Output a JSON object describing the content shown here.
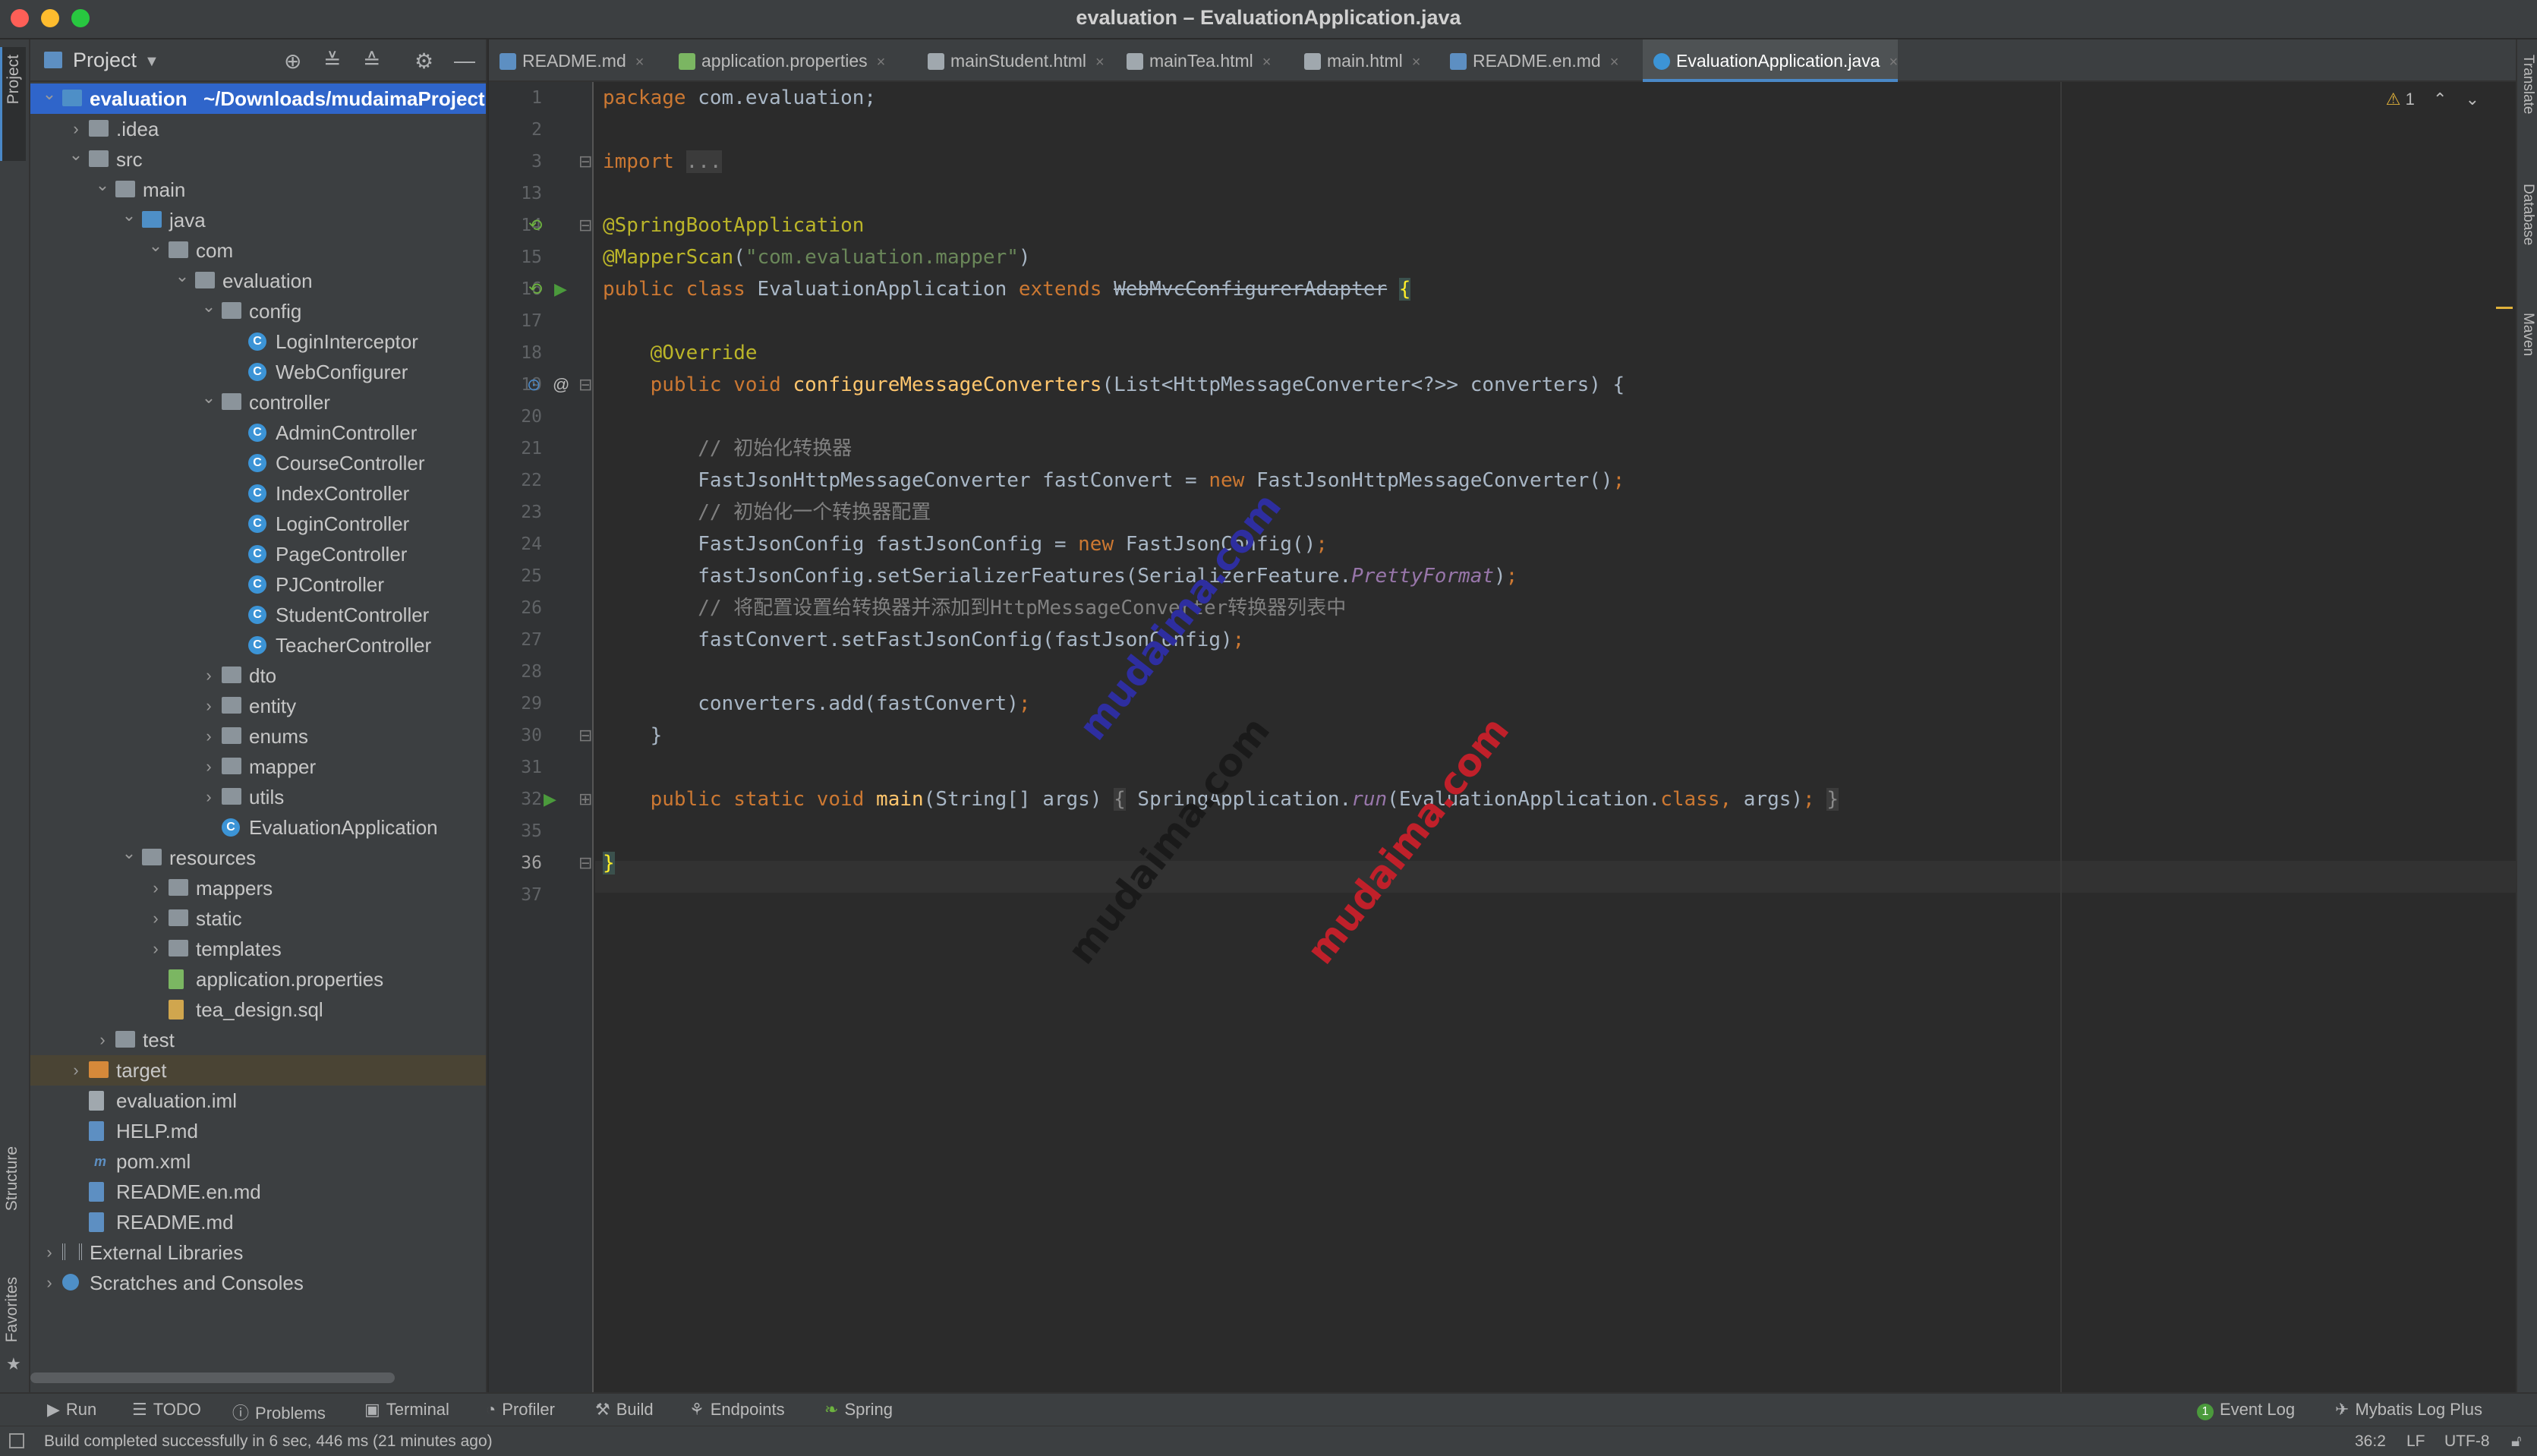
{
  "window": {
    "title": "evaluation – EvaluationApplication.java"
  },
  "left_strip": {
    "project_label": "Project",
    "structure_label": "Structure",
    "favorites_label": "Favorites"
  },
  "right_strip": {
    "translate_label": "Translate",
    "database_label": "Database",
    "maven_label": "Maven"
  },
  "project_panel": {
    "title": "Project",
    "tree": [
      {
        "label": "evaluation",
        "suffix": "~/Downloads/mudaimaProject",
        "level": 0,
        "arrow": "down",
        "icon": "folder-module",
        "selected": true
      },
      {
        "label": ".idea",
        "level": 1,
        "arrow": "right",
        "icon": "folder"
      },
      {
        "label": "src",
        "level": 1,
        "arrow": "down",
        "icon": "folder"
      },
      {
        "label": "main",
        "level": 2,
        "arrow": "down",
        "icon": "folder"
      },
      {
        "label": "java",
        "level": 3,
        "arrow": "down",
        "icon": "folder-blue"
      },
      {
        "label": "com",
        "level": 4,
        "arrow": "down",
        "icon": "folder"
      },
      {
        "label": "evaluation",
        "level": 5,
        "arrow": "down",
        "icon": "folder"
      },
      {
        "label": "config",
        "level": 6,
        "arrow": "down",
        "icon": "folder"
      },
      {
        "label": "LoginInterceptor",
        "level": 7,
        "icon": "class"
      },
      {
        "label": "WebConfigurer",
        "level": 7,
        "icon": "class"
      },
      {
        "label": "controller",
        "level": 6,
        "arrow": "down",
        "icon": "folder"
      },
      {
        "label": "AdminController",
        "level": 7,
        "icon": "class"
      },
      {
        "label": "CourseController",
        "level": 7,
        "icon": "class"
      },
      {
        "label": "IndexController",
        "level": 7,
        "icon": "class"
      },
      {
        "label": "LoginController",
        "level": 7,
        "icon": "class"
      },
      {
        "label": "PageController",
        "level": 7,
        "icon": "class"
      },
      {
        "label": "PJController",
        "level": 7,
        "icon": "class"
      },
      {
        "label": "StudentController",
        "level": 7,
        "icon": "class"
      },
      {
        "label": "TeacherController",
        "level": 7,
        "icon": "class"
      },
      {
        "label": "dto",
        "level": 6,
        "arrow": "right",
        "icon": "folder"
      },
      {
        "label": "entity",
        "level": 6,
        "arrow": "right",
        "icon": "folder"
      },
      {
        "label": "enums",
        "level": 6,
        "arrow": "right",
        "icon": "folder"
      },
      {
        "label": "mapper",
        "level": 6,
        "arrow": "right",
        "icon": "folder"
      },
      {
        "label": "utils",
        "level": 6,
        "arrow": "right",
        "icon": "folder"
      },
      {
        "label": "EvaluationApplication",
        "level": 6,
        "icon": "spring-class"
      },
      {
        "label": "resources",
        "level": 3,
        "arrow": "down",
        "icon": "folder-resources"
      },
      {
        "label": "mappers",
        "level": 4,
        "arrow": "right",
        "icon": "folder"
      },
      {
        "label": "static",
        "level": 4,
        "arrow": "right",
        "icon": "folder"
      },
      {
        "label": "templates",
        "level": 4,
        "arrow": "right",
        "icon": "folder"
      },
      {
        "label": "application.properties",
        "level": 4,
        "icon": "properties-file"
      },
      {
        "label": "tea_design.sql",
        "level": 4,
        "icon": "sql-file"
      },
      {
        "label": "test",
        "level": 2,
        "arrow": "right",
        "icon": "folder"
      },
      {
        "label": "target",
        "level": 1,
        "arrow": "right",
        "icon": "folder-orange",
        "highlight": true
      },
      {
        "label": "evaluation.iml",
        "level": 1,
        "icon": "iml-file"
      },
      {
        "label": "HELP.md",
        "level": 1,
        "icon": "md-file"
      },
      {
        "label": "pom.xml",
        "level": 1,
        "icon": "maven-file"
      },
      {
        "label": "README.en.md",
        "level": 1,
        "icon": "md-file"
      },
      {
        "label": "README.md",
        "level": 1,
        "icon": "md-file"
      },
      {
        "label": "External Libraries",
        "level": 0,
        "arrow": "right",
        "icon": "libraries"
      },
      {
        "label": "Scratches and Consoles",
        "level": 0,
        "arrow": "right",
        "icon": "scratches"
      }
    ]
  },
  "tabs": [
    {
      "label": "README.md",
      "icon": "md-file",
      "color": "#5d8fc2"
    },
    {
      "label": "application.properties",
      "icon": "properties-file",
      "color": "#7bb662"
    },
    {
      "label": "mainStudent.html",
      "icon": "html-file",
      "color": "#a0a8ae"
    },
    {
      "label": "mainTea.html",
      "icon": "html-file",
      "color": "#a0a8ae"
    },
    {
      "label": "main.html",
      "icon": "html-file",
      "color": "#a0a8ae"
    },
    {
      "label": "README.en.md",
      "icon": "md-file",
      "color": "#5d8fc2"
    },
    {
      "label": "EvaluationApplication.java",
      "icon": "spring-class",
      "color": "#3c94d6",
      "active": true
    }
  ],
  "editor": {
    "warning_count": "1",
    "current_line": "36",
    "lines": [
      {
        "n": "1",
        "html": "<span class=\"kw\">package</span> com.evaluation;"
      },
      {
        "n": "2",
        "html": ""
      },
      {
        "n": "3",
        "html": "<span class=\"kw\">import</span> <span class=\"fold\">...</span>"
      },
      {
        "n": "13",
        "html": ""
      },
      {
        "n": "14",
        "html": "<span class=\"ann\">@SpringBootApplication</span>"
      },
      {
        "n": "15",
        "html": "<span class=\"ann\">@MapperScan</span>(<span class=\"str\">\"com.evaluation.mapper\"</span>)"
      },
      {
        "n": "16",
        "html": "<span class=\"kw\">public class</span> EvaluationApplication <span class=\"kw\">extends</span> <span class=\"strike\">WebMvcConfigurerAdapter</span> <span class=\"brace-hl\">{</span>"
      },
      {
        "n": "17",
        "html": ""
      },
      {
        "n": "18",
        "html": "    <span class=\"ann\">@Override</span>"
      },
      {
        "n": "19",
        "html": "    <span class=\"kw\">public void</span> <span class=\"fn\">configureMessageConverters</span>(List&lt;HttpMessageConverter&lt;?&gt;&gt; converters) {"
      },
      {
        "n": "20",
        "html": ""
      },
      {
        "n": "21",
        "html": "        <span class=\"cmt\">// 初始化转换器</span>"
      },
      {
        "n": "22",
        "html": "        FastJsonHttpMessageConverter fastConvert = <span class=\"kw\">new</span> FastJsonHttpMessageConverter()<span class=\"kw\">;</span>"
      },
      {
        "n": "23",
        "html": "        <span class=\"cmt\">// 初始化一个转换器配置</span>"
      },
      {
        "n": "24",
        "html": "        FastJsonConfig fastJsonConfig = <span class=\"kw\">new</span> FastJsonConfig()<span class=\"kw\">;</span>"
      },
      {
        "n": "25",
        "html": "        fastJsonConfig.setSerializerFeatures(SerializerFeature.<span class=\"it\">PrettyFormat</span>)<span class=\"kw\">;</span>"
      },
      {
        "n": "26",
        "html": "        <span class=\"cmt\">// 将配置设置给转换器并添加到HttpMessageConverter转换器列表中</span>"
      },
      {
        "n": "27",
        "html": "        fastConvert.setFastJsonConfig(fastJsonConfig)<span class=\"kw\">;</span>"
      },
      {
        "n": "28",
        "html": ""
      },
      {
        "n": "29",
        "html": "        converters.add(fastConvert)<span class=\"kw\">;</span>"
      },
      {
        "n": "30",
        "html": "    }"
      },
      {
        "n": "31",
        "html": ""
      },
      {
        "n": "32",
        "html": "    <span class=\"kw\">public static void</span> <span class=\"fn\">main</span>(String[] args) <span class=\"fold\">{</span> SpringApplication.<span class=\"it\">run</span>(EvaluationApplication.<span class=\"kw\">class,</span> args)<span class=\"kw\">;</span> <span class=\"fold\">}</span>"
      },
      {
        "n": "35",
        "html": ""
      },
      {
        "n": "36",
        "html": "<span class=\"brace-hl\">}</span>"
      },
      {
        "n": "37",
        "html": ""
      }
    ]
  },
  "tool_windows": {
    "run": "Run",
    "todo": "TODO",
    "problems": "Problems",
    "terminal": "Terminal",
    "profiler": "Profiler",
    "build": "Build",
    "endpoints": "Endpoints",
    "spring": "Spring",
    "event_log": "Event Log",
    "event_log_count": "1",
    "mybatis_log": "Mybatis Log Plus"
  },
  "status_bar": {
    "message": "Build completed successfully in 6 sec, 446 ms (21 minutes ago)",
    "position": "36:2",
    "line_separator": "LF",
    "encoding": "UTF-8"
  },
  "watermarks": [
    "mudaima.com",
    "mudaima.com",
    "mudaima.com"
  ],
  "colors": {
    "accent": "#4a88c7",
    "selection": "#2f65ca",
    "keyword": "#cc7832",
    "annotation": "#bbb529",
    "string": "#6a8759",
    "comment": "#808080",
    "function": "#ffc66d",
    "watermark_blue": "#3a3aa8",
    "watermark_red": "#c0202a",
    "watermark_dark": "#1a1a1a"
  }
}
